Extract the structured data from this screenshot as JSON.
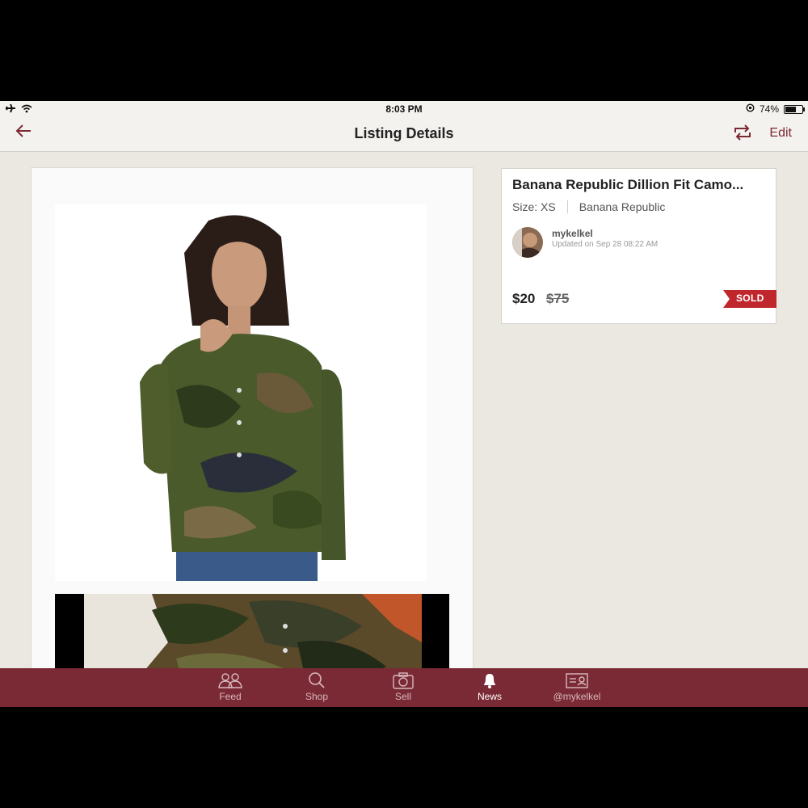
{
  "status_bar": {
    "time": "8:03 PM",
    "battery_text": "74%",
    "battery_level": 0.74
  },
  "nav": {
    "title": "Listing Details",
    "edit_label": "Edit"
  },
  "listing": {
    "title": "Banana Republic Dillion Fit Camo...",
    "size": "Size: XS",
    "brand": "Banana Republic",
    "seller": "mykelkel",
    "updated": "Updated on Sep 28 08:22 AM",
    "price": "$20",
    "original_price": "$75",
    "status_badge": "SOLD"
  },
  "tabs": [
    {
      "label": "Feed",
      "icon": "people-icon"
    },
    {
      "label": "Shop",
      "icon": "search-icon"
    },
    {
      "label": "Sell",
      "icon": "camera-icon"
    },
    {
      "label": "News",
      "icon": "bell-icon",
      "active": true
    },
    {
      "label": "@mykelkel",
      "icon": "profile-card-icon"
    }
  ],
  "colors": {
    "brand": "#7a2a35",
    "accent": "#7b2a33",
    "sold": "#c0272d",
    "background": "#ebe8e2"
  }
}
